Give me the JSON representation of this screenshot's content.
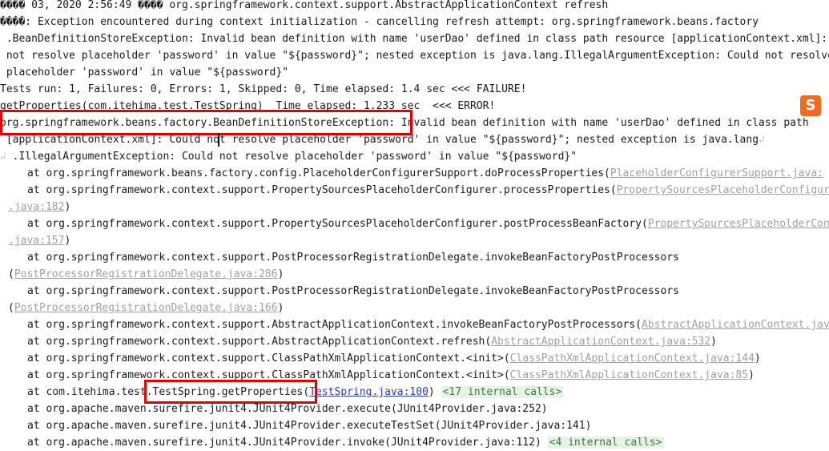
{
  "lines": [
    {
      "text": "���� 03, 2020 2:56:49 ���� org.springframework.context.support.AbstractApplicationContext refresh"
    },
    {
      "text": "����: Exception encountered during context initialization - cancelling refresh attempt: org.springframework.beans.factory"
    },
    {
      "text": " .BeanDefinitionStoreException: Invalid bean definition with name 'userDao' defined in class path resource [applicationContext.xml]: Could"
    },
    {
      "text": " not resolve placeholder 'password' in value \"${password}\"; nested exception is java.lang.IllegalArgumentException: Could not resolve"
    },
    {
      "text": " placeholder 'password' in value \"${password}\""
    },
    {
      "text": "Tests run: 1, Failures: 0, Errors: 1, Skipped: 0, Time elapsed: 1.4 sec <<< FAILURE!"
    },
    {
      "text": "getProperties(com.itehima.test.TestSpring)  Time elapsed: 1.233 sec  <<< ERROR!"
    },
    {
      "text": "org.springframework.beans.factory.BeanDefinitionStoreException: Invalid bean definition with name 'userDao' defined in class path"
    },
    {
      "text": " [applicationContext.xml]: Could not resolve placeholder 'password' in value \"${password}\"; nested exception is java.lang"
    },
    {
      "text": " .IllegalArgumentException: Could not resolve placeholder 'password' in value \"${password}\""
    }
  ],
  "wrap_glyph": "↲",
  "frames": [
    {
      "prefix": "at org.springframework.beans.factory.config.PlaceholderConfigurerSupport.doProcessProperties(",
      "link": "PlaceholderConfigurerSupport.java:",
      "suffix": ""
    },
    {
      "prefix": "at org.springframework.context.support.PropertySourcesPlaceholderConfigurer.processProperties(",
      "link": "PropertySourcesPlaceholderConfigurer",
      "suffix": ""
    },
    {
      "cont": ".java:182",
      "suffix": ")"
    },
    {
      "prefix": "at org.springframework.context.support.PropertySourcesPlaceholderConfigurer.postProcessBeanFactory(",
      "link": "PropertySourcesPlaceholderConfigurer",
      "suffix": ""
    },
    {
      "cont": ".java:157",
      "suffix": ")"
    },
    {
      "prefix": "at org.springframework.context.support.PostProcessorRegistrationDelegate.invokeBeanFactoryPostProcessors",
      "link": "",
      "suffix": ""
    },
    {
      "open": "(",
      "cont": "PostProcessorRegistrationDelegate.java:286",
      "suffix": ")"
    },
    {
      "prefix": "at org.springframework.context.support.PostProcessorRegistrationDelegate.invokeBeanFactoryPostProcessors",
      "link": "",
      "suffix": ""
    },
    {
      "open": "(",
      "cont": "PostProcessorRegistrationDelegate.java:166",
      "suffix": ")"
    },
    {
      "prefix": "at org.springframework.context.support.AbstractApplicationContext.invokeBeanFactoryPostProcessors(",
      "link": "AbstractApplicationContext.java:",
      "suffix": ""
    },
    {
      "prefix": "at org.springframework.context.support.AbstractApplicationContext.refresh(",
      "link": "AbstractApplicationContext.java:532",
      "suffix": ")"
    },
    {
      "prefix": "at org.springframework.context.support.ClassPathXmlApplicationContext.<init>(",
      "link": "ClassPathXmlApplicationContext.java:144",
      "suffix": ")"
    },
    {
      "prefix": "at org.springframework.context.support.ClassPathXmlApplicationContext.<init>(",
      "link": "ClassPathXmlApplicationContext.java:85",
      "suffix": ")"
    },
    {
      "prefix": "at com.itehima.test.TestSpring.getProperties(",
      "link_blue": "TestSpring.java:100",
      "suffix": ") ",
      "internal": "<17 internal calls>"
    },
    {
      "prefix": "at org.apache.maven.surefire.junit4.JUnit4Provider.execute(JUnit4Provider.java:252)",
      "link": "",
      "suffix": ""
    },
    {
      "prefix": "at org.apache.maven.surefire.junit4.JUnit4Provider.executeTestSet(JUnit4Provider.java:141)",
      "link": "",
      "suffix": ""
    },
    {
      "prefix": "at org.apache.maven.surefire.junit4.JUnit4Provider.invoke(JUnit4Provider.java:112) ",
      "link": "",
      "suffix": "",
      "internal": "<4 internal calls>"
    }
  ],
  "ime_icon_label": "S"
}
